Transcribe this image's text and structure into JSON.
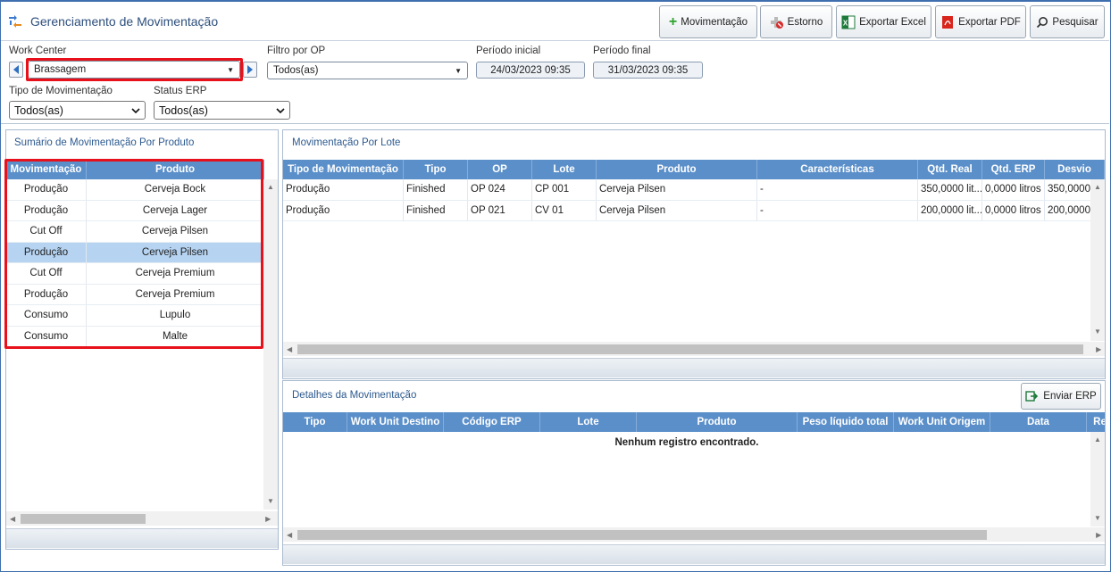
{
  "app": {
    "title": "Gerenciamento de Movimentação"
  },
  "toolbar": {
    "movimentacao": "Movimentação",
    "estorno": "Estorno",
    "exportar_excel": "Exportar Excel",
    "exportar_pdf": "Exportar PDF",
    "pesquisar": "Pesquisar"
  },
  "filters": {
    "work_center": {
      "label": "Work Center",
      "value": "Brassagem"
    },
    "filtro_op": {
      "label": "Filtro por OP",
      "value": "Todos(as)"
    },
    "periodo_inicial": {
      "label": "Período inicial",
      "value": "24/03/2023 09:35"
    },
    "periodo_final": {
      "label": "Período final",
      "value": "31/03/2023 09:35"
    },
    "tipo_movimentacao": {
      "label": "Tipo de Movimentação",
      "value": "Todos(as)"
    },
    "status_erp": {
      "label": "Status ERP",
      "value": "Todos(as)"
    }
  },
  "summary": {
    "title": "Sumário de Movimentação Por Produto",
    "columns": [
      "Movimentação",
      "Produto"
    ],
    "rows": [
      [
        "Produção",
        "Cerveja Bock"
      ],
      [
        "Produção",
        "Cerveja Lager"
      ],
      [
        "Cut Off",
        "Cerveja Pilsen"
      ],
      [
        "Produção",
        "Cerveja Pilsen"
      ],
      [
        "Cut Off",
        "Cerveja Premium"
      ],
      [
        "Produção",
        "Cerveja Premium"
      ],
      [
        "Consumo",
        "Lupulo"
      ],
      [
        "Consumo",
        "Malte"
      ]
    ]
  },
  "lote": {
    "title": "Movimentação Por Lote",
    "columns": [
      "Tipo de Movimentação",
      "Tipo",
      "OP",
      "Lote",
      "Produto",
      "Características",
      "Qtd. Real",
      "Qtd. ERP",
      "Desvio"
    ],
    "rows": [
      [
        "Produção",
        "Finished",
        "OP 024",
        "CP 001",
        "Cerveja Pilsen",
        "-",
        "350,0000 lit...",
        "0,0000 litros",
        "350,0000"
      ],
      [
        "Produção",
        "Finished",
        "OP 021",
        "CV 01",
        "Cerveja Pilsen",
        "-",
        "200,0000 lit...",
        "0,0000 litros",
        "200,0000"
      ]
    ]
  },
  "detalhes": {
    "title": "Detalhes da Movimentação",
    "enviar_erp": "Enviar ERP",
    "columns": [
      "Tipo",
      "Work Unit Destino",
      "Código ERP",
      "Lote",
      "Produto",
      "Peso líquido total",
      "Work Unit Origem",
      "Data",
      "Re"
    ],
    "empty": "Nenhum registro encontrado."
  },
  "colors": {
    "header": "#5b8fc9",
    "selected_row": "#b6d4f2",
    "highlight": "#e8111b",
    "title": "#2d4f7c"
  }
}
